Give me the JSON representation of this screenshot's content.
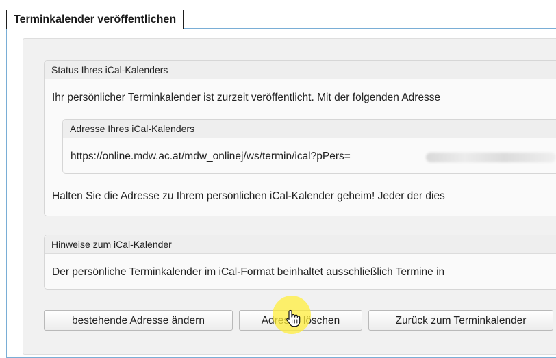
{
  "page_title": "Terminkalender veröffentlichen",
  "status_section": {
    "legend": "Status Ihres iCal-Kalenders",
    "message": "Ihr persönlicher Terminkalender ist zurzeit veröffentlicht. Mit der folgenden Adresse",
    "address_section": {
      "legend": "Adresse Ihres iCal-Kalenders",
      "url": "https://online.mdw.ac.at/mdw_onlinej/ws/termin/ical?pPers="
    },
    "warning": "Halten Sie die Adresse zu Ihrem persönlichen iCal-Kalender geheim! Jeder der dies"
  },
  "hints_section": {
    "legend": "Hinweise zum iCal-Kalender",
    "text": "Der persönliche Terminkalender im iCal-Format beinhaltet ausschließlich Termine in"
  },
  "buttons": {
    "change_address": "bestehende Adresse ändern",
    "delete_address": "Adresse löschen",
    "back_to_calendar": "Zurück zum Terminkalender"
  },
  "colors": {
    "frame_border": "#7aaed6",
    "click_highlight": "#ffee3c"
  },
  "icons": {
    "cursor": "hand-pointer-icon"
  }
}
